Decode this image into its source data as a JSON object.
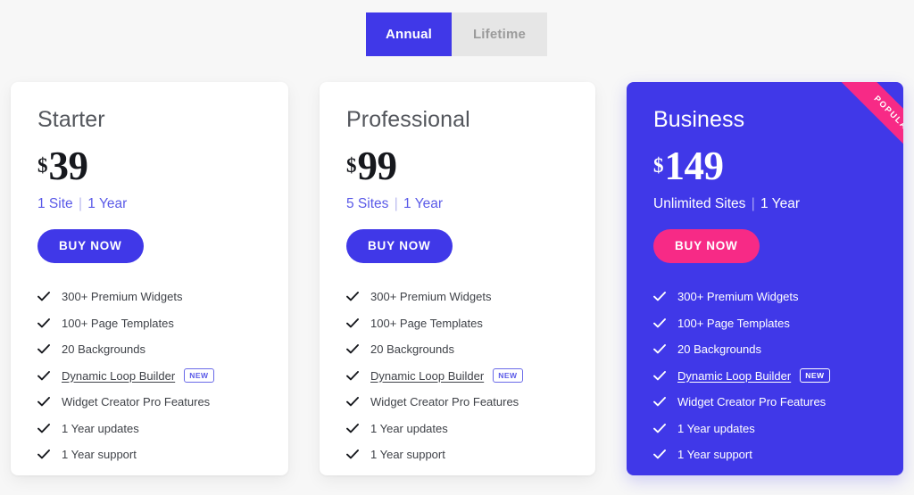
{
  "billing_toggle": {
    "options": [
      {
        "label": "Annual",
        "active": true
      },
      {
        "label": "Lifetime",
        "active": false
      }
    ]
  },
  "colors": {
    "brand_blue": "#4038e8",
    "accent_pink": "#f72a86",
    "page_background": "#f7f7f7",
    "card_background": "#ffffff",
    "terms_text": "#5a5ae8",
    "toggle_inactive_background": "#e6e6e6",
    "toggle_inactive_text": "#9b9b9b"
  },
  "badges": {
    "new_label": "NEW",
    "popular_label": "POPULAR"
  },
  "plans": [
    {
      "name": "Starter",
      "currency": "$",
      "amount": "39",
      "sites": "1 Site",
      "separator": "|",
      "term": "1 Year",
      "cta_label": "BUY NOW",
      "featured": false,
      "popular": false,
      "features": [
        {
          "text": "300+ Premium Widgets",
          "link": false,
          "badge": ""
        },
        {
          "text": "100+ Page Templates",
          "link": false,
          "badge": ""
        },
        {
          "text": "20 Backgrounds",
          "link": false,
          "badge": ""
        },
        {
          "text": "Dynamic Loop Builder",
          "link": true,
          "badge": "NEW"
        },
        {
          "text": "Widget Creator Pro Features",
          "link": false,
          "badge": ""
        },
        {
          "text": "1 Year updates",
          "link": false,
          "badge": ""
        },
        {
          "text": "1 Year support",
          "link": false,
          "badge": ""
        }
      ]
    },
    {
      "name": "Professional",
      "currency": "$",
      "amount": "99",
      "sites": "5 Sites",
      "separator": "|",
      "term": "1 Year",
      "cta_label": "BUY NOW",
      "featured": false,
      "popular": false,
      "features": [
        {
          "text": "300+ Premium Widgets",
          "link": false,
          "badge": ""
        },
        {
          "text": "100+ Page Templates",
          "link": false,
          "badge": ""
        },
        {
          "text": "20 Backgrounds",
          "link": false,
          "badge": ""
        },
        {
          "text": "Dynamic Loop Builder",
          "link": true,
          "badge": "NEW"
        },
        {
          "text": "Widget Creator Pro Features",
          "link": false,
          "badge": ""
        },
        {
          "text": "1 Year updates",
          "link": false,
          "badge": ""
        },
        {
          "text": "1 Year support",
          "link": false,
          "badge": ""
        }
      ]
    },
    {
      "name": "Business",
      "currency": "$",
      "amount": "149",
      "sites": "Unlimited Sites",
      "separator": "|",
      "term": "1 Year",
      "cta_label": "BUY NOW",
      "featured": true,
      "popular": true,
      "features": [
        {
          "text": "300+ Premium Widgets",
          "link": false,
          "badge": ""
        },
        {
          "text": "100+ Page Templates",
          "link": false,
          "badge": ""
        },
        {
          "text": "20 Backgrounds",
          "link": false,
          "badge": ""
        },
        {
          "text": "Dynamic Loop Builder",
          "link": true,
          "badge": "NEW"
        },
        {
          "text": "Widget Creator Pro Features",
          "link": false,
          "badge": ""
        },
        {
          "text": "1 Year updates",
          "link": false,
          "badge": ""
        },
        {
          "text": "1 Year support",
          "link": false,
          "badge": ""
        }
      ]
    }
  ]
}
